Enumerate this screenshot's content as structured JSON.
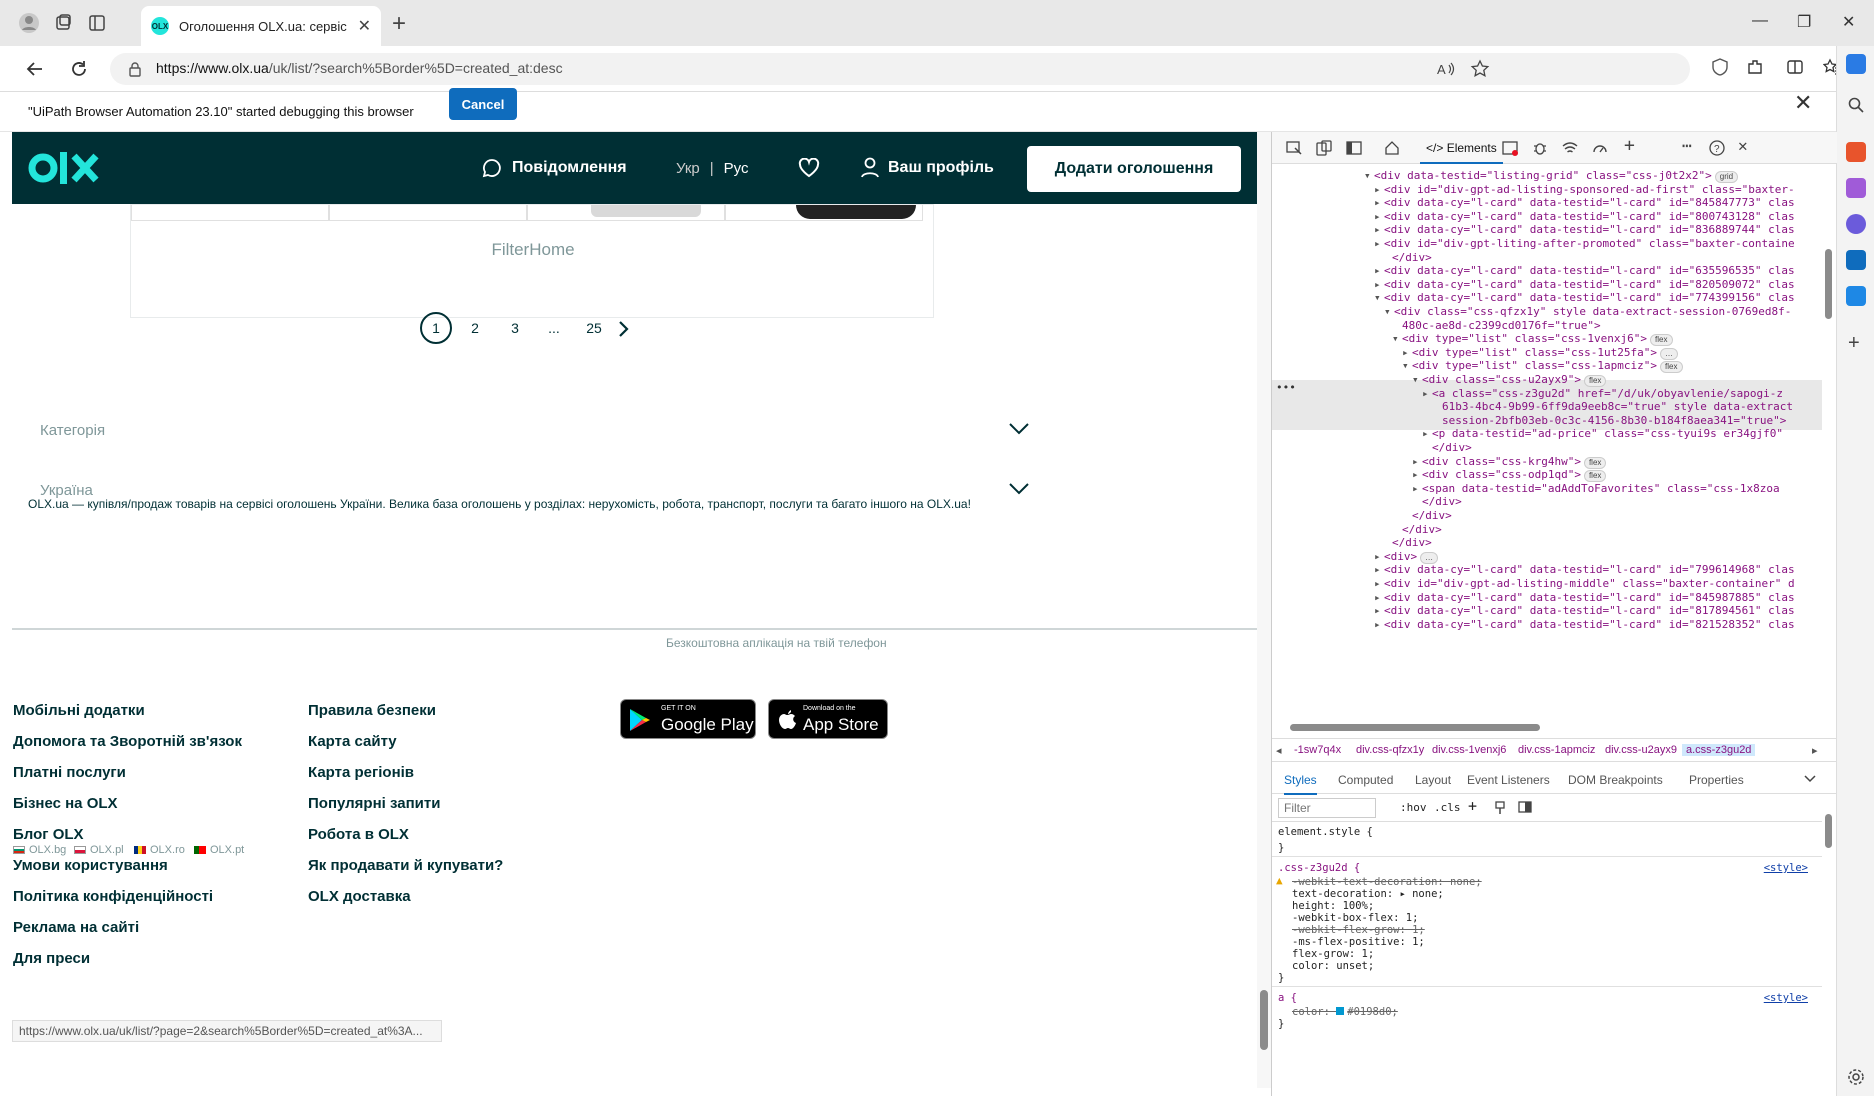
{
  "browser": {
    "tab_title": "Оголошення OLX.ua: сервіс ого...",
    "tab_favicon": "OLX",
    "url_host": "https://www.olx.ua",
    "url_path": "/uk/list/?search%5Border%5D=created_at:desc",
    "debug_message": "\"UiPath Browser Automation 23.10\" started debugging this browser",
    "debug_cancel": "Cancel"
  },
  "olx_header": {
    "messages": "Повідомлення",
    "lang_uk": "Укр",
    "lang_sep": "|",
    "lang_ru": "Рус",
    "profile": "Ваш профіль",
    "add_listing": "Додати оголошення"
  },
  "card": {
    "filter_home": "FilterHome"
  },
  "pagination": {
    "pages": [
      "1",
      "2",
      "3",
      "...",
      "25"
    ],
    "current": "1"
  },
  "accordions": {
    "category": "Категорія",
    "region": "Україна"
  },
  "description": "OLX.ua — купівля/продаж товарів на сервісі оголошень України. Велика база оголошень у розділах: нерухомість, робота, транспорт, послуги та багато іншого на OLX.ua!",
  "footer": {
    "col1": [
      "Мобільні додатки",
      "Допомога та Зворотній зв'язок",
      "Платні послуги",
      "Бізнес на OLX",
      "Блог OLX",
      "Умови користування",
      "Політика конфіденційності",
      "Реклама на сайті",
      "Для преси"
    ],
    "col2": [
      "Правила безпеки",
      "Карта сайту",
      "Карта регіонів",
      "Популярні запити",
      "Робота в OLX",
      "Як продавати й купувати?",
      "OLX доставка"
    ],
    "google_small": "GET IT ON",
    "google_big": "Google Play",
    "apple_small": "Download on the",
    "apple_big": "App Store",
    "apps_tagline": "Безкоштовна аплікація на твій телефон",
    "countries": [
      "OLX.bg",
      "OLX.pl",
      "OLX.ro",
      "OLX.pt"
    ]
  },
  "status_url": "https://www.olx.ua/uk/list/?page=2&search%5Border%5D=created_at%3A...",
  "devtools": {
    "elements_tab": "Elements",
    "breadcrumbs": [
      "-1sw7q4x",
      "div.css-qfzx1y",
      "div.css-1venxj6",
      "div.css-1apmciz",
      "div.css-u2ayx9",
      "a.css-z3gu2d"
    ],
    "style_tabs": [
      "Styles",
      "Computed",
      "Layout",
      "Event Listeners",
      "DOM Breakpoints",
      "Properties"
    ],
    "filter_placeholder": "Filter",
    "hov": ":hov",
    "cls": ".cls",
    "dom_lines": [
      "<div data-testid=\"listing-grid\" class=\"css-j0t2x2\">",
      "<div id=\"div-gpt-ad-listing-sponsored-ad-first\" class=\"baxter-",
      "<div data-cy=\"l-card\" data-testid=\"l-card\" id=\"845847773\" clas",
      "<div data-cy=\"l-card\" data-testid=\"l-card\" id=\"800743128\" clas",
      "<div data-cy=\"l-card\" data-testid=\"l-card\" id=\"836889744\" clas",
      "<div id=\"div-gpt-liting-after-promoted\" class=\"baxter-containe",
      "</div>",
      "<div data-cy=\"l-card\" data-testid=\"l-card\" id=\"635596535\" clas",
      "<div data-cy=\"l-card\" data-testid=\"l-card\" id=\"820509072\" clas",
      "<div data-cy=\"l-card\" data-testid=\"l-card\" id=\"774399156\" clas",
      "<div class=\"css-qfzx1y\" style data-extract-session-0769ed8f-",
      "480c-ae8d-c2399cd0176f=\"true\">",
      "<div type=\"list\" class=\"css-1venxj6\">",
      "<div type=\"list\" class=\"css-1ut25fa\">",
      "<div type=\"list\" class=\"css-1apmciz\">",
      "<div class=\"css-u2ayx9\">",
      "<a class=\"css-z3gu2d\" href=\"/d/uk/obyavlenie/sapogi-z",
      "61b3-4bc4-9b99-6ff9da9eeb8c=\"true\" style data-extract",
      "session-2bfb03eb-0c3c-4156-8b30-b184f8aea341=\"true\">",
      "<p data-testid=\"ad-price\" class=\"css-tyui9s er34gjf0\"",
      "</div>",
      "<div class=\"css-krg4hw\">",
      "<div class=\"css-odp1qd\">",
      "<span data-testid=\"adAddToFavorites\" class=\"css-1x8zoa",
      "</div>",
      "</div>",
      "</div>",
      "</div>",
      "<div>",
      "<div data-cy=\"l-card\" data-testid=\"l-card\" id=\"799614968\" clas",
      "<div id=\"div-gpt-ad-listing-middle\" class=\"baxter-container\" d",
      "<div data-cy=\"l-card\" data-testid=\"l-card\" id=\"845987885\" clas",
      "<div data-cy=\"l-card\" data-testid=\"l-card\" id=\"817894561\" clas",
      "<div data-cy=\"l-card\" data-testid=\"l-card\" id=\"821528352\" clas"
    ],
    "css": {
      "element_style": "element.style {",
      "rule1_selector": ".css-z3gu2d {",
      "rule1_source": "<style>",
      "rule1_props": [
        "-webkit-text-decoration: none;",
        "text-decoration: ▸ none;",
        "height: 100%;",
        "-webkit-box-flex: 1;",
        "-webkit-flex-grow: 1;",
        "-ms-flex-positive: 1;",
        "flex-grow: 1;",
        "color: unset;"
      ],
      "rule2_selector": "a {",
      "rule2_source": "<style>",
      "rule2_prop": "color: ",
      "rule2_value": "#0198d0;",
      "close": "}"
    }
  }
}
